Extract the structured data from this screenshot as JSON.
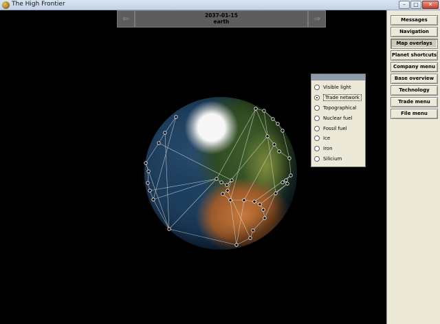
{
  "window": {
    "title": "The High Frontier",
    "controls": {
      "minimize": "–",
      "maximize": "□",
      "close": "✕"
    }
  },
  "header": {
    "prev_arrow": "⇐",
    "next_arrow": "⇒",
    "date": "2037-01-15",
    "planet": "earth"
  },
  "overlay_panel": {
    "selected": "Trade network",
    "options": [
      "Visible light",
      "Trade network",
      "Topographical",
      "Nuclear fuel",
      "Fossil fuel",
      "Ice",
      "Iron",
      "Silicium"
    ]
  },
  "sidebar": {
    "active": "Map overlays",
    "buttons": [
      "Messages",
      "Navigation",
      "Map overlays",
      "Planet shortcuts",
      "Company menu",
      "Base overview",
      "Technology",
      "Trade menu",
      "File menu"
    ]
  },
  "icons": {
    "app": "planet-app-icon",
    "radio_on": "radio-selected",
    "radio_off": "radio-unselected"
  },
  "colors": {
    "background": "#000000",
    "panel": "#ece9d8",
    "header": "#5d5d5d",
    "network_line": "#d8d8d8"
  }
}
